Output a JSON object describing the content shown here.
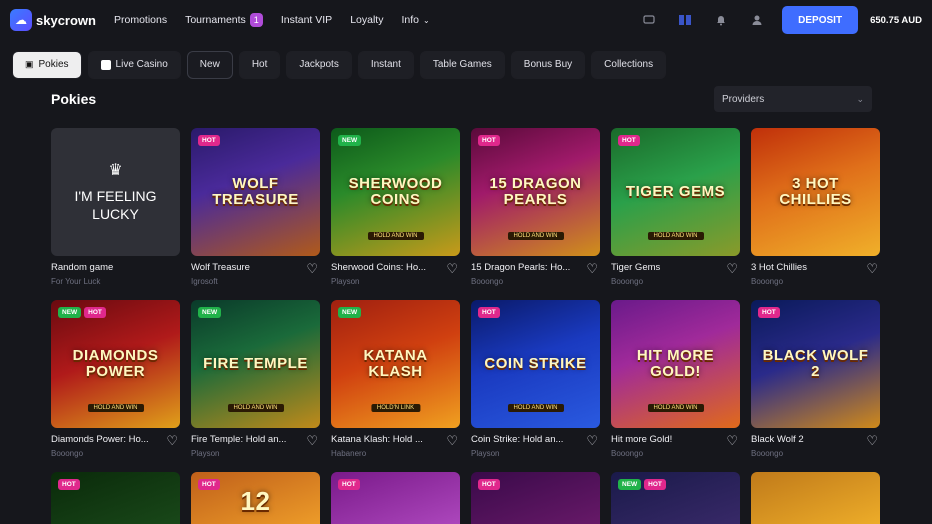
{
  "brand": {
    "name": "skycrown"
  },
  "nav": [
    {
      "label": "Promotions"
    },
    {
      "label": "Tournaments",
      "badge": "1"
    },
    {
      "label": "Instant VIP"
    },
    {
      "label": "Loyalty"
    },
    {
      "label": "Info"
    }
  ],
  "header": {
    "deposit_label": "DEPOSIT",
    "balance": "650.75 AUD"
  },
  "tabs": [
    {
      "label": "Pokies"
    },
    {
      "label": "Live Casino"
    },
    {
      "label": "New"
    },
    {
      "label": "Hot"
    },
    {
      "label": "Jackpots"
    },
    {
      "label": "Instant"
    },
    {
      "label": "Table Games"
    },
    {
      "label": "Bonus Buy"
    },
    {
      "label": "Collections"
    }
  ],
  "section": {
    "title": "Pokies",
    "providers_label": "Providers"
  },
  "lucky": {
    "text1": "I'M FEELING",
    "text2": "LUCKY"
  },
  "games": [
    {
      "name": "Random game",
      "provider": "For Your Luck",
      "art": "",
      "tags": []
    },
    {
      "name": "Wolf Treasure",
      "provider": "Igrosoft",
      "art": "WOLF TREASURE",
      "tags": [
        "HOT"
      ]
    },
    {
      "name": "Sherwood Coins: Ho...",
      "provider": "Playson",
      "art": "SHERWOOD COINS",
      "sub": "HOLD AND WIN",
      "tags": [
        "NEW"
      ]
    },
    {
      "name": "15 Dragon Pearls: Ho...",
      "provider": "Booongo",
      "art": "15 DRAGON PEARLS",
      "sub": "HOLD AND WIN",
      "tags": [
        "HOT"
      ]
    },
    {
      "name": "Tiger Gems",
      "provider": "Booongo",
      "art": "TIGER GEMS",
      "sub": "HOLD AND WIN",
      "tags": [
        "HOT"
      ]
    },
    {
      "name": "3 Hot Chillies",
      "provider": "Booongo",
      "art": "3 HOT CHILLIES",
      "tags": []
    },
    {
      "name": "Diamonds Power: Ho...",
      "provider": "Booongo",
      "art": "DIAMONDS POWER",
      "sub": "HOLD AND WIN",
      "tags": [
        "NEW",
        "HOT"
      ]
    },
    {
      "name": "Fire Temple: Hold an...",
      "provider": "Playson",
      "art": "FIRE TEMPLE",
      "sub": "HOLD AND WIN",
      "tags": [
        "NEW"
      ]
    },
    {
      "name": "Katana Klash: Hold ...",
      "provider": "Habanero",
      "art": "KATANA KLASH",
      "sub": "HOLD'N LINK",
      "tags": [
        "NEW"
      ]
    },
    {
      "name": "Coin Strike: Hold an...",
      "provider": "Playson",
      "art": "COIN STRIKE",
      "sub": "HOLD AND WIN",
      "tags": [
        "HOT"
      ]
    },
    {
      "name": "Hit more Gold!",
      "provider": "Booongo",
      "art": "HIT MORE GOLD!",
      "sub": "HOLD AND WIN",
      "tags": []
    },
    {
      "name": "Black Wolf 2",
      "provider": "Booongo",
      "art": "BLACK WOLF 2",
      "tags": [
        "HOT"
      ]
    }
  ],
  "row3": [
    {
      "tags": [
        "HOT"
      ]
    },
    {
      "tags": [
        "HOT"
      ],
      "art": "12"
    },
    {
      "tags": [
        "HOT"
      ]
    },
    {
      "tags": [
        "HOT"
      ]
    },
    {
      "tags": [
        "NEW",
        "HOT"
      ]
    },
    {
      "tags": []
    }
  ]
}
